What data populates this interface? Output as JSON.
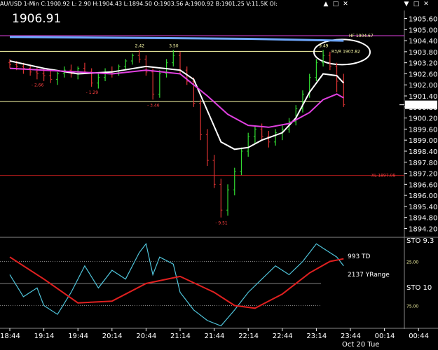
{
  "window": {
    "symbol_line": "AU/USD 1-Min   C:1900.92   L: 2.90   H:1904.43   L:1894.50   O:1903.56   A:1900.92   B:1901.25   V:11.5K   OI:",
    "controls": [
      "▲",
      "□",
      "✕",
      "▼",
      "□",
      "✕"
    ]
  },
  "big_price": "1906.91",
  "chart_data": [
    {
      "type": "line",
      "panel": "price",
      "y_ticks": [
        "1905.60",
        "1905.00",
        "1904.40",
        "1903.80",
        "1903.20",
        "1902.60",
        "1902.00",
        "1901.40",
        "1900.80",
        "1900.20",
        "1899.60",
        "1899.00",
        "1898.40",
        "1897.80",
        "1897.20",
        "1896.60",
        "1896.00",
        "1895.40",
        "1894.80",
        "1894.20"
      ],
      "ylim": [
        1893.8,
        1906.0
      ],
      "last_price_label": "1900.92",
      "x_ticks": [
        "18:44",
        "19:14",
        "19:44",
        "20:14",
        "20:44",
        "21:14",
        "21:44",
        "22:14",
        "22:44",
        "23:14",
        "23:44",
        "00:14",
        "00:44"
      ],
      "date_label": "Oct 20 Tue",
      "xlim": [
        "18:44",
        "00:59"
      ],
      "bars": [
        {
          "t": "18:44",
          "o": 1903.2,
          "h": 1903.4,
          "l": 1902.9,
          "c": 1903.1
        },
        {
          "t": "18:50",
          "o": 1903.1,
          "h": 1903.3,
          "l": 1902.8,
          "c": 1903.0
        },
        {
          "t": "18:56",
          "o": 1903.0,
          "h": 1903.2,
          "l": 1902.6,
          "c": 1902.9
        },
        {
          "t": "19:02",
          "o": 1902.9,
          "h": 1903.1,
          "l": 1902.5,
          "c": 1902.7
        },
        {
          "t": "19:08",
          "o": 1902.7,
          "h": 1903.0,
          "l": 1902.3,
          "c": 1902.6
        },
        {
          "t": "19:14",
          "o": 1902.6,
          "h": 1902.9,
          "l": 1902.2,
          "c": 1902.5
        },
        {
          "t": "19:20",
          "o": 1902.5,
          "h": 1902.8,
          "l": 1902.1,
          "c": 1902.3
        },
        {
          "t": "19:26",
          "o": 1902.3,
          "h": 1902.7,
          "l": 1902.0,
          "c": 1902.6
        },
        {
          "t": "19:32",
          "o": 1902.6,
          "h": 1903.0,
          "l": 1902.4,
          "c": 1902.8
        },
        {
          "t": "19:38",
          "o": 1902.8,
          "h": 1903.1,
          "l": 1902.4,
          "c": 1902.6
        },
        {
          "t": "19:44",
          "o": 1902.6,
          "h": 1903.0,
          "l": 1902.3,
          "c": 1902.9
        },
        {
          "t": "19:50",
          "o": 1902.9,
          "h": 1903.2,
          "l": 1902.6,
          "c": 1902.7
        },
        {
          "t": "19:56",
          "o": 1902.7,
          "h": 1902.9,
          "l": 1901.9,
          "c": 1902.1
        },
        {
          "t": "20:02",
          "o": 1902.1,
          "h": 1902.6,
          "l": 1901.8,
          "c": 1902.4
        },
        {
          "t": "20:08",
          "o": 1902.4,
          "h": 1902.9,
          "l": 1902.2,
          "c": 1902.7
        },
        {
          "t": "20:14",
          "o": 1902.7,
          "h": 1903.0,
          "l": 1902.4,
          "c": 1902.6
        },
        {
          "t": "20:20",
          "o": 1902.6,
          "h": 1903.1,
          "l": 1902.5,
          "c": 1903.0
        },
        {
          "t": "20:26",
          "o": 1903.0,
          "h": 1903.4,
          "l": 1902.8,
          "c": 1903.3
        },
        {
          "t": "20:32",
          "o": 1903.3,
          "h": 1903.7,
          "l": 1903.1,
          "c": 1903.6
        },
        {
          "t": "20:38",
          "o": 1903.6,
          "h": 1903.9,
          "l": 1903.2,
          "c": 1903.4
        },
        {
          "t": "20:44",
          "o": 1903.4,
          "h": 1903.6,
          "l": 1902.5,
          "c": 1902.7
        },
        {
          "t": "20:50",
          "o": 1902.7,
          "h": 1902.9,
          "l": 1901.2,
          "c": 1901.5
        },
        {
          "t": "20:56",
          "o": 1901.5,
          "h": 1902.8,
          "l": 1901.3,
          "c": 1902.6
        },
        {
          "t": "21:02",
          "o": 1902.6,
          "h": 1903.4,
          "l": 1902.4,
          "c": 1903.2
        },
        {
          "t": "21:08",
          "o": 1903.2,
          "h": 1903.9,
          "l": 1903.0,
          "c": 1903.6
        },
        {
          "t": "21:14",
          "o": 1903.6,
          "h": 1903.8,
          "l": 1902.6,
          "c": 1902.8
        },
        {
          "t": "21:20",
          "o": 1902.8,
          "h": 1903.0,
          "l": 1902.0,
          "c": 1902.2
        },
        {
          "t": "21:26",
          "o": 1902.2,
          "h": 1902.4,
          "l": 1900.8,
          "c": 1901.0
        },
        {
          "t": "21:32",
          "o": 1901.0,
          "h": 1901.2,
          "l": 1899.0,
          "c": 1899.3
        },
        {
          "t": "21:38",
          "o": 1899.3,
          "h": 1899.6,
          "l": 1897.6,
          "c": 1897.9
        },
        {
          "t": "21:44",
          "o": 1897.9,
          "h": 1898.2,
          "l": 1896.4,
          "c": 1896.6
        },
        {
          "t": "21:50",
          "o": 1896.6,
          "h": 1896.9,
          "l": 1894.8,
          "c": 1895.2
        },
        {
          "t": "21:56",
          "o": 1895.2,
          "h": 1896.6,
          "l": 1894.9,
          "c": 1896.3
        },
        {
          "t": "22:02",
          "o": 1896.3,
          "h": 1897.5,
          "l": 1896.0,
          "c": 1897.3
        },
        {
          "t": "22:08",
          "o": 1897.3,
          "h": 1898.6,
          "l": 1897.1,
          "c": 1898.4
        },
        {
          "t": "22:14",
          "o": 1898.4,
          "h": 1899.4,
          "l": 1898.1,
          "c": 1899.2
        },
        {
          "t": "22:20",
          "o": 1899.2,
          "h": 1899.8,
          "l": 1898.8,
          "c": 1899.6
        },
        {
          "t": "22:26",
          "o": 1899.6,
          "h": 1899.9,
          "l": 1899.0,
          "c": 1899.2
        },
        {
          "t": "22:32",
          "o": 1899.2,
          "h": 1899.5,
          "l": 1898.6,
          "c": 1898.9
        },
        {
          "t": "22:38",
          "o": 1898.9,
          "h": 1899.6,
          "l": 1898.7,
          "c": 1899.4
        },
        {
          "t": "22:44",
          "o": 1899.4,
          "h": 1899.8,
          "l": 1899.0,
          "c": 1899.6
        },
        {
          "t": "22:50",
          "o": 1899.6,
          "h": 1900.2,
          "l": 1899.4,
          "c": 1900.0
        },
        {
          "t": "22:56",
          "o": 1900.0,
          "h": 1900.9,
          "l": 1899.8,
          "c": 1900.7
        },
        {
          "t": "23:02",
          "o": 1900.7,
          "h": 1901.7,
          "l": 1900.5,
          "c": 1901.5
        },
        {
          "t": "23:08",
          "o": 1901.5,
          "h": 1902.6,
          "l": 1901.3,
          "c": 1902.4
        },
        {
          "t": "23:14",
          "o": 1902.4,
          "h": 1903.4,
          "l": 1902.2,
          "c": 1903.2
        },
        {
          "t": "23:20",
          "o": 1903.2,
          "h": 1903.9,
          "l": 1903.0,
          "c": 1903.6
        },
        {
          "t": "23:26",
          "o": 1903.6,
          "h": 1903.8,
          "l": 1902.8,
          "c": 1903.0
        },
        {
          "t": "23:32",
          "o": 1903.0,
          "h": 1903.2,
          "l": 1901.6,
          "c": 1902.2
        },
        {
          "t": "23:38",
          "o": 1902.2,
          "h": 1902.6,
          "l": 1900.8,
          "c": 1900.92
        }
      ],
      "series": [
        {
          "color": "#ffffff",
          "values": [
            {
              "t": "18:44",
              "y": 1903.3
            },
            {
              "t": "19:14",
              "y": 1902.9
            },
            {
              "t": "19:44",
              "y": 1902.6
            },
            {
              "t": "20:14",
              "y": 1902.7
            },
            {
              "t": "20:44",
              "y": 1903.0
            },
            {
              "t": "21:14",
              "y": 1902.8
            },
            {
              "t": "21:26",
              "y": 1902.3
            },
            {
              "t": "21:38",
              "y": 1900.6
            },
            {
              "t": "21:50",
              "y": 1898.9
            },
            {
              "t": "22:02",
              "y": 1898.5
            },
            {
              "t": "22:14",
              "y": 1898.6
            },
            {
              "t": "22:26",
              "y": 1899.0
            },
            {
              "t": "22:44",
              "y": 1899.4
            },
            {
              "t": "22:56",
              "y": 1900.2
            },
            {
              "t": "23:08",
              "y": 1901.6
            },
            {
              "t": "23:20",
              "y": 1902.6
            },
            {
              "t": "23:32",
              "y": 1902.5
            },
            {
              "t": "23:38",
              "y": 1902.1
            }
          ]
        },
        {
          "color": "#e040e0",
          "values": [
            {
              "t": "18:44",
              "y": 1902.9
            },
            {
              "t": "19:14",
              "y": 1902.8
            },
            {
              "t": "19:44",
              "y": 1902.7
            },
            {
              "t": "20:14",
              "y": 1902.6
            },
            {
              "t": "20:44",
              "y": 1902.8
            },
            {
              "t": "21:14",
              "y": 1902.6
            },
            {
              "t": "21:38",
              "y": 1901.4
            },
            {
              "t": "21:56",
              "y": 1900.4
            },
            {
              "t": "22:14",
              "y": 1899.8
            },
            {
              "t": "22:32",
              "y": 1899.7
            },
            {
              "t": "22:50",
              "y": 1899.9
            },
            {
              "t": "23:08",
              "y": 1900.5
            },
            {
              "t": "23:20",
              "y": 1901.2
            },
            {
              "t": "23:32",
              "y": 1901.5
            },
            {
              "t": "23:38",
              "y": 1901.3
            }
          ]
        },
        {
          "color": "#6fa8ff",
          "values": [
            {
              "t": "18:44",
              "y": 1904.6
            },
            {
              "t": "20:44",
              "y": 1904.55
            },
            {
              "t": "22:14",
              "y": 1904.5
            },
            {
              "t": "23:38",
              "y": 1904.4
            }
          ]
        }
      ],
      "levels": [
        {
          "y": 1903.82,
          "color": "#ffffaa",
          "label": "R3/R 1903.82"
        },
        {
          "y": 1901.1,
          "color": "#ffffaa",
          "label": ""
        },
        {
          "y": 1897.08,
          "color": "#d02020",
          "label": "XL 1897.08"
        },
        {
          "y": 1904.67,
          "color": "#e040e0",
          "label": "HF 1904.67"
        }
      ],
      "peak_labels": [
        {
          "t": "20:38",
          "y": 1903.9,
          "text": "2.42"
        },
        {
          "t": "21:08",
          "y": 1903.9,
          "text": "3.50"
        },
        {
          "t": "23:20",
          "y": 1903.9,
          "text": "9.49"
        }
      ],
      "trough_labels": [
        {
          "t": "19:08",
          "y": 1902.3,
          "text": "- 2.66"
        },
        {
          "t": "19:56",
          "y": 1901.9,
          "text": "- 1.29"
        },
        {
          "t": "20:50",
          "y": 1901.2,
          "text": "- 3.46"
        },
        {
          "t": "21:50",
          "y": 1894.8,
          "text": "- 9.51"
        }
      ]
    },
    {
      "type": "line",
      "panel": "stochastic",
      "annotations": [
        "993 TD",
        "2137 YRange"
      ],
      "y_ticks": [
        "25.00",
        "75.00"
      ],
      "right_labels": [
        "STO 9.3",
        "STO 10"
      ],
      "ylim": [
        0,
        100
      ],
      "series": [
        {
          "color": "#4fc3d9",
          "values": [
            {
              "t": "18:44",
              "y": 40
            },
            {
              "t": "18:56",
              "y": 65
            },
            {
              "t": "19:08",
              "y": 55
            },
            {
              "t": "19:14",
              "y": 75
            },
            {
              "t": "19:26",
              "y": 85
            },
            {
              "t": "19:38",
              "y": 60
            },
            {
              "t": "19:50",
              "y": 30
            },
            {
              "t": "20:02",
              "y": 55
            },
            {
              "t": "20:14",
              "y": 35
            },
            {
              "t": "20:26",
              "y": 45
            },
            {
              "t": "20:38",
              "y": 15
            },
            {
              "t": "20:44",
              "y": 5
            },
            {
              "t": "20:50",
              "y": 40
            },
            {
              "t": "20:56",
              "y": 20
            },
            {
              "t": "21:08",
              "y": 28
            },
            {
              "t": "21:14",
              "y": 60
            },
            {
              "t": "21:26",
              "y": 80
            },
            {
              "t": "21:38",
              "y": 92
            },
            {
              "t": "21:50",
              "y": 98
            },
            {
              "t": "22:02",
              "y": 80
            },
            {
              "t": "22:14",
              "y": 60
            },
            {
              "t": "22:26",
              "y": 45
            },
            {
              "t": "22:38",
              "y": 30
            },
            {
              "t": "22:50",
              "y": 40
            },
            {
              "t": "23:02",
              "y": 25
            },
            {
              "t": "23:14",
              "y": 5
            },
            {
              "t": "23:20",
              "y": 10
            },
            {
              "t": "23:26",
              "y": 15
            },
            {
              "t": "23:32",
              "y": 20
            },
            {
              "t": "23:38",
              "y": 30
            }
          ]
        },
        {
          "color": "#e02020",
          "values": [
            {
              "t": "18:44",
              "y": 20
            },
            {
              "t": "19:14",
              "y": 45
            },
            {
              "t": "19:44",
              "y": 72
            },
            {
              "t": "20:14",
              "y": 70
            },
            {
              "t": "20:44",
              "y": 50
            },
            {
              "t": "21:14",
              "y": 42
            },
            {
              "t": "21:44",
              "y": 60
            },
            {
              "t": "22:02",
              "y": 75
            },
            {
              "t": "22:20",
              "y": 78
            },
            {
              "t": "22:44",
              "y": 62
            },
            {
              "t": "23:08",
              "y": 38
            },
            {
              "t": "23:26",
              "y": 25
            },
            {
              "t": "23:38",
              "y": 22
            }
          ]
        }
      ]
    }
  ]
}
